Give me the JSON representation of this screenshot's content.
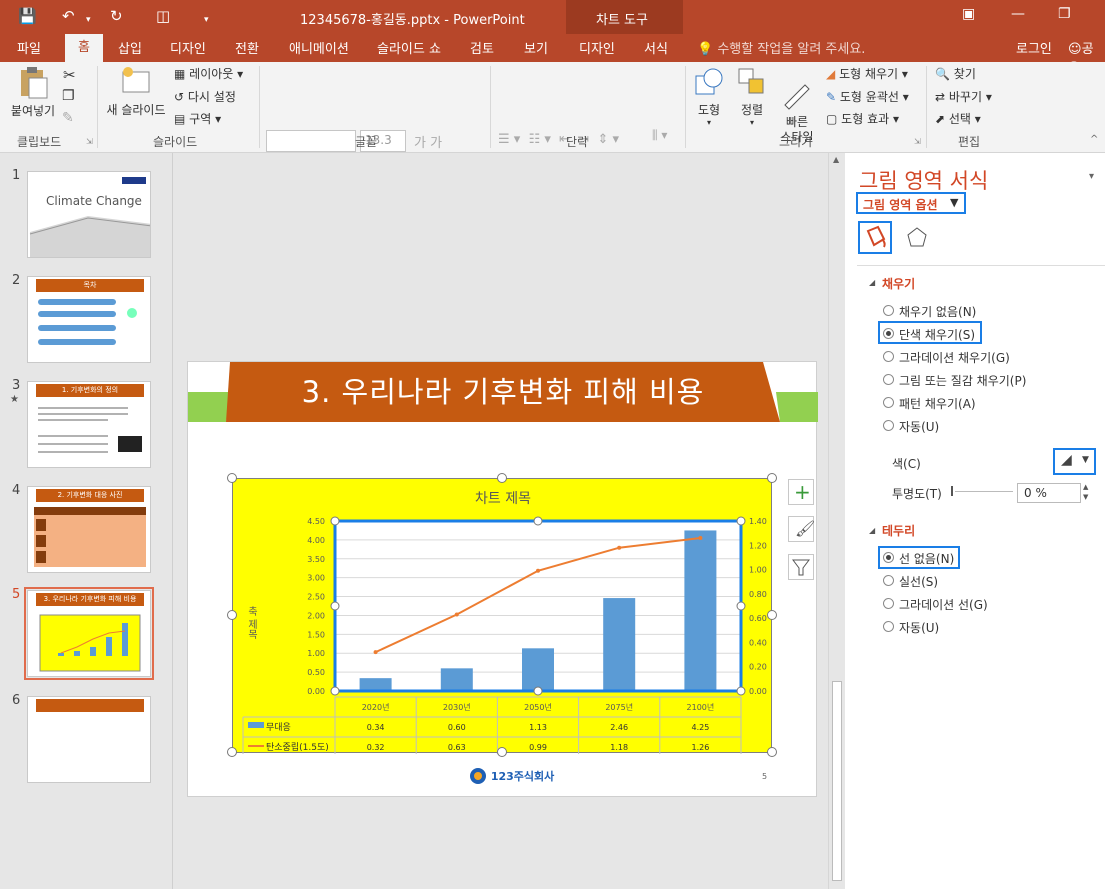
{
  "window": {
    "title": "12345678-홍길동.pptx - PowerPoint",
    "context_tab_group": "차트 도구",
    "signin": "로그인",
    "share": "공유"
  },
  "tabs": [
    "파일",
    "홈",
    "삽입",
    "디자인",
    "전환",
    "애니메이션",
    "슬라이드 쇼",
    "검토",
    "보기",
    "디자인",
    "서식"
  ],
  "tell_me": "수행할 작업을 알려 주세요.",
  "ribbon": {
    "paste": "붙여넣기",
    "new_slide": "새 슬라이드",
    "layout": "레이아웃",
    "reset": "다시 설정",
    "section": "구역",
    "font_size": "13.3",
    "shape": "도형",
    "arrange": "정렬",
    "quick_style": "빠른\n스타일",
    "shape_fill": "도형 채우기",
    "shape_outline": "도형 윤곽선",
    "shape_effect": "도형 효과",
    "find": "찾기",
    "replace": "바꾸기",
    "select": "선택",
    "groups": [
      "클립보드",
      "슬라이드",
      "글꼴",
      "단락",
      "그리기",
      "편집"
    ]
  },
  "thumbnails": [
    {
      "num": "1",
      "title": "Climate Change"
    },
    {
      "num": "2",
      "title": "목차"
    },
    {
      "num": "3",
      "title": "1. 기후변화의 정의"
    },
    {
      "num": "4",
      "title": "2. 기후변화 대응 사진"
    },
    {
      "num": "5",
      "title": "3. 우리나라 기후변화 피해 비용"
    },
    {
      "num": "6",
      "title": ""
    }
  ],
  "slide": {
    "title": "3. 우리나라 기후변화 피해 비용",
    "page": "5",
    "logo": "123주식회사"
  },
  "chart_data": {
    "type": "bar",
    "title": "차트 제목",
    "categories": [
      "2020년",
      "2030년",
      "2050년",
      "2075년",
      "2100년"
    ],
    "series": [
      {
        "name": "무대응",
        "type": "bar",
        "axis": "left",
        "values": [
          0.34,
          0.6,
          1.13,
          2.46,
          4.25
        ],
        "color": "#5b9bd5"
      },
      {
        "name": "탄소중립(1.5도)",
        "type": "line",
        "axis": "right",
        "values": [
          0.32,
          0.63,
          0.99,
          1.18,
          1.26
        ],
        "color": "#ed7d31"
      }
    ],
    "ylim": [
      0,
      4.5
    ],
    "y_ticks": [
      "4.50",
      "4.00",
      "3.50",
      "3.00",
      "2.50",
      "2.00",
      "1.50",
      "1.00",
      "0.50",
      "0.00"
    ],
    "y2lim": [
      0,
      1.4
    ],
    "y2_ticks": [
      "1.40",
      "1.20",
      "1.00",
      "0.80",
      "0.60",
      "0.40",
      "0.20",
      "0.00"
    ],
    "ylabel": "축 제목",
    "data_table": true,
    "table_rows": [
      {
        "name": "무대응",
        "cells": [
          "0.34",
          "0.60",
          "1.13",
          "2.46",
          "4.25"
        ]
      },
      {
        "name": "탄소중립(1.5도)",
        "cells": [
          "0.32",
          "0.63",
          "0.99",
          "1.18",
          "1.26"
        ]
      }
    ],
    "background": "#ffff00",
    "grid": true
  },
  "pane": {
    "title": "그림 영역 서식",
    "options_dropdown": "그림 영역 옵션",
    "fill_section": "채우기",
    "fill_options": [
      "채우기 없음(N)",
      "단색 채우기(S)",
      "그라데이션 채우기(G)",
      "그림 또는 질감 채우기(P)",
      "패턴 채우기(A)",
      "자동(U)"
    ],
    "fill_selected": 1,
    "color_label": "색(C)",
    "transparency_label": "투명도(T)",
    "transparency_value": "0 %",
    "border_section": "테두리",
    "border_options": [
      "선 없음(N)",
      "실선(S)",
      "그라데이션 선(G)",
      "자동(U)"
    ],
    "border_selected": 0
  }
}
